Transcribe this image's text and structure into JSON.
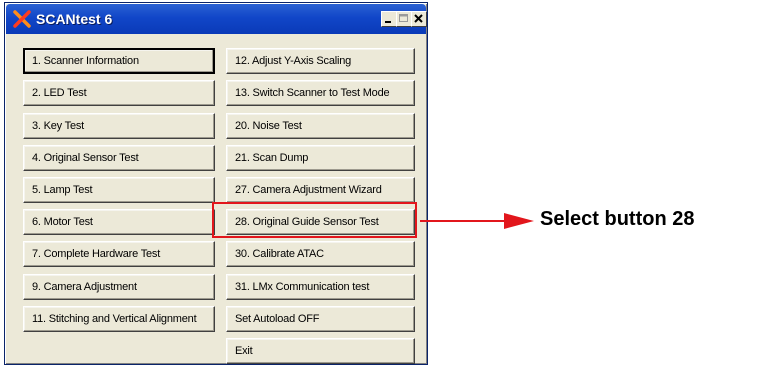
{
  "window": {
    "title": "SCANtest 6"
  },
  "left_buttons": [
    {
      "label": "1. Scanner Information"
    },
    {
      "label": "2. LED Test"
    },
    {
      "label": "3. Key Test"
    },
    {
      "label": "4. Original Sensor Test"
    },
    {
      "label": "5. Lamp Test"
    },
    {
      "label": "6. Motor Test"
    },
    {
      "label": "7. Complete Hardware Test"
    },
    {
      "label": "9. Camera Adjustment"
    },
    {
      "label": "11. Stitching and Vertical Alignment"
    }
  ],
  "right_buttons": [
    {
      "label": "12. Adjust Y-Axis Scaling"
    },
    {
      "label": "13. Switch Scanner to Test Mode"
    },
    {
      "label": "20. Noise Test"
    },
    {
      "label": "21. Scan Dump"
    },
    {
      "label": "27. Camera Adjustment Wizard"
    },
    {
      "label": "28. Original Guide Sensor Test"
    },
    {
      "label": "30. Calibrate ATAC"
    },
    {
      "label": "31. LMx Communication test"
    },
    {
      "label": "Set Autoload OFF"
    },
    {
      "label": "Exit"
    }
  ],
  "annotation": {
    "callout_text": "Select button 28",
    "highlight_color": "#e2161c"
  },
  "icons": {
    "app": "x-logo-icon",
    "minimize": "minimize-icon",
    "maximize": "maximize-icon",
    "close": "close-icon"
  },
  "colors": {
    "titlebar": "#0a3ab8",
    "window_face": "#ece9d8",
    "annotation_red": "#e2161c"
  }
}
